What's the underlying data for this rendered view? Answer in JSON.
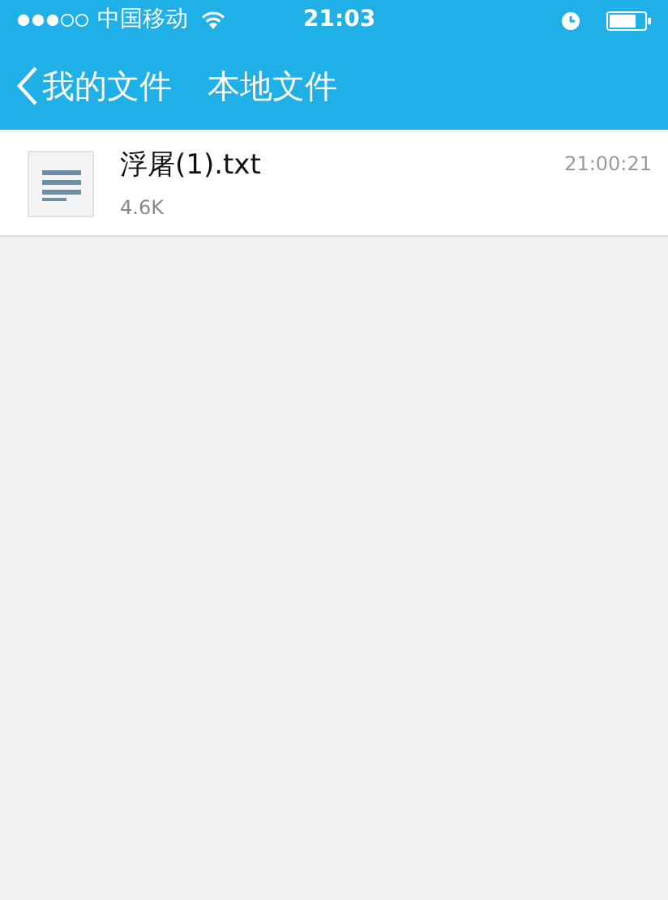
{
  "status_bar": {
    "carrier": "中国移动",
    "time": "21:03"
  },
  "nav_bar": {
    "back": "我的文件",
    "title": "本地文件"
  },
  "files": [
    {
      "name": "浮屠(1).txt",
      "size": "4.6K",
      "time": "21:00:21"
    }
  ]
}
